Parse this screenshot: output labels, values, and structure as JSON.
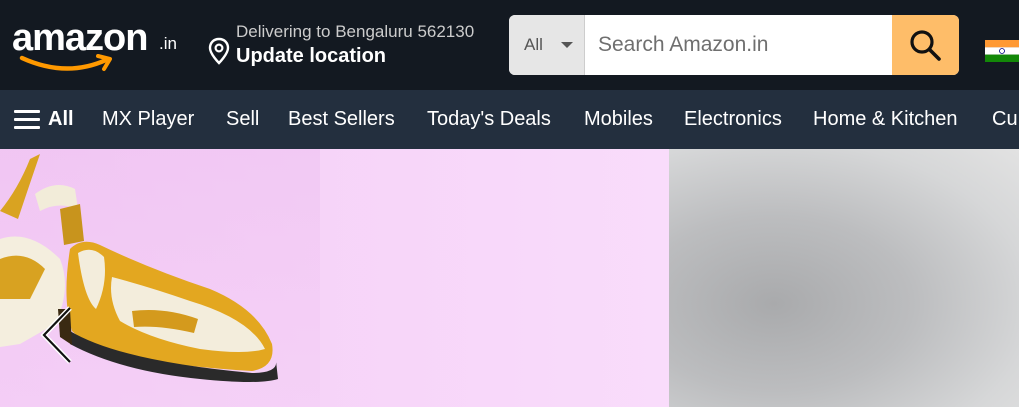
{
  "header": {
    "logo_text": "amazon",
    "logo_suffix": ".in",
    "delivery": {
      "line1": "Delivering to Bengaluru 562130",
      "line2": "Update location"
    },
    "search": {
      "category": "All",
      "placeholder": "Search Amazon.in"
    }
  },
  "nav": {
    "all_label": "All",
    "items": [
      "MX Player",
      "Sell",
      "Best Sellers",
      "Today's Deals",
      "Mobiles",
      "Electronics",
      "Home & Kitchen",
      "Cu"
    ]
  },
  "colors": {
    "header_bg": "#131921",
    "nav_bg": "#232f3e",
    "search_button": "#febd69",
    "logo_smile": "#ff9900"
  },
  "icons": {
    "location": "map-pin-icon",
    "search": "magnifier-icon",
    "flag": "india-flag-icon",
    "menu": "hamburger-icon",
    "carousel_prev": "chevron-left-icon"
  }
}
